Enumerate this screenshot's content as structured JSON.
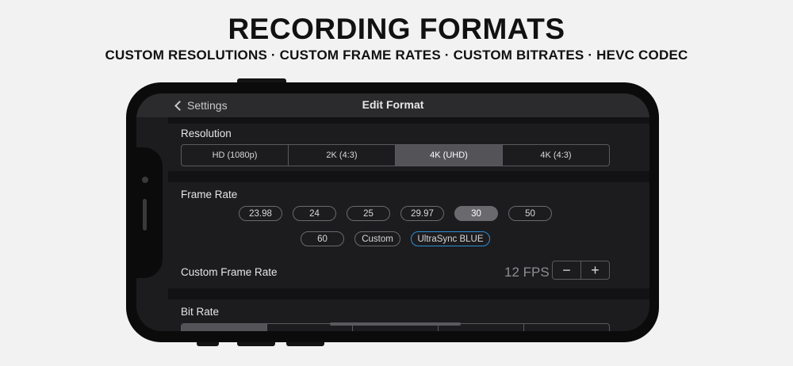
{
  "promo": {
    "headline": "RECORDING FORMATS",
    "subheadline": "CUSTOM RESOLUTIONS · CUSTOM FRAME RATES · CUSTOM BITRATES · HEVC CODEC"
  },
  "navbar": {
    "back_label": "Settings",
    "title": "Edit Format"
  },
  "resolution": {
    "label": "Resolution",
    "options": [
      "HD (1080p)",
      "2K (4:3)",
      "4K (UHD)",
      "4K (4:3)"
    ],
    "selected": "4K (UHD)"
  },
  "frame_rate": {
    "label": "Frame Rate",
    "row1": [
      "23.98",
      "24",
      "25",
      "29.97",
      "30",
      "50"
    ],
    "row2": [
      "60",
      "Custom",
      "UltraSync BLUE"
    ],
    "selected": "30"
  },
  "custom_frame_rate": {
    "label": "Custom Frame Rate",
    "value": "12 FPS",
    "decrement": "−",
    "increment": "+"
  },
  "bit_rate": {
    "label": "Bit Rate"
  },
  "colors": {
    "accent_blue": "#2f8fd6",
    "selected_segment": "#545458",
    "background": "#1c1c1e"
  }
}
